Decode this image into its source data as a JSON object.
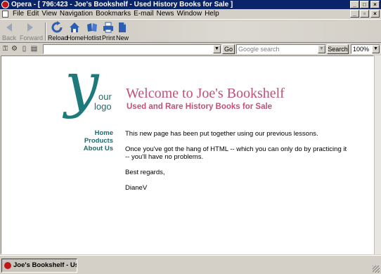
{
  "window": {
    "title": "Opera - [ 796:423 - Joe's Bookshelf - Used History Books for Sale ]"
  },
  "menu": {
    "items": [
      "File",
      "Edit",
      "View",
      "Navigation",
      "Bookmarks",
      "E-mail",
      "News",
      "Window",
      "Help"
    ]
  },
  "toolbar": {
    "back": "Back",
    "forward": "Forward",
    "reload": "Reload",
    "home": "Home",
    "hotlist": "Hotlist",
    "print": "Print",
    "new": "New"
  },
  "address": {
    "url": "",
    "go": "Go",
    "search_placeholder": "Google search",
    "search_button": "Search",
    "zoom": "100%"
  },
  "page": {
    "logo_our": "our",
    "logo_logo": "logo",
    "title": "Welcome to Joe's Bookshelf",
    "subtitle": "Used and Rare History Books for Sale",
    "nav": [
      "Home",
      "Products",
      "About Us"
    ],
    "paragraphs": [
      "This new page has been put together using our previous lessons.",
      "Once you've got the hang of HTML -- which you can only do by practicing it -- you'll have no problems.",
      "Best regards,",
      "DianeV"
    ]
  },
  "taskbar": {
    "task_label": "Joe's Bookshelf - Use..."
  },
  "colors": {
    "title_bar": "#0a246a",
    "heading_pink": "#c0507a",
    "nav_teal": "#1e6a6a"
  }
}
